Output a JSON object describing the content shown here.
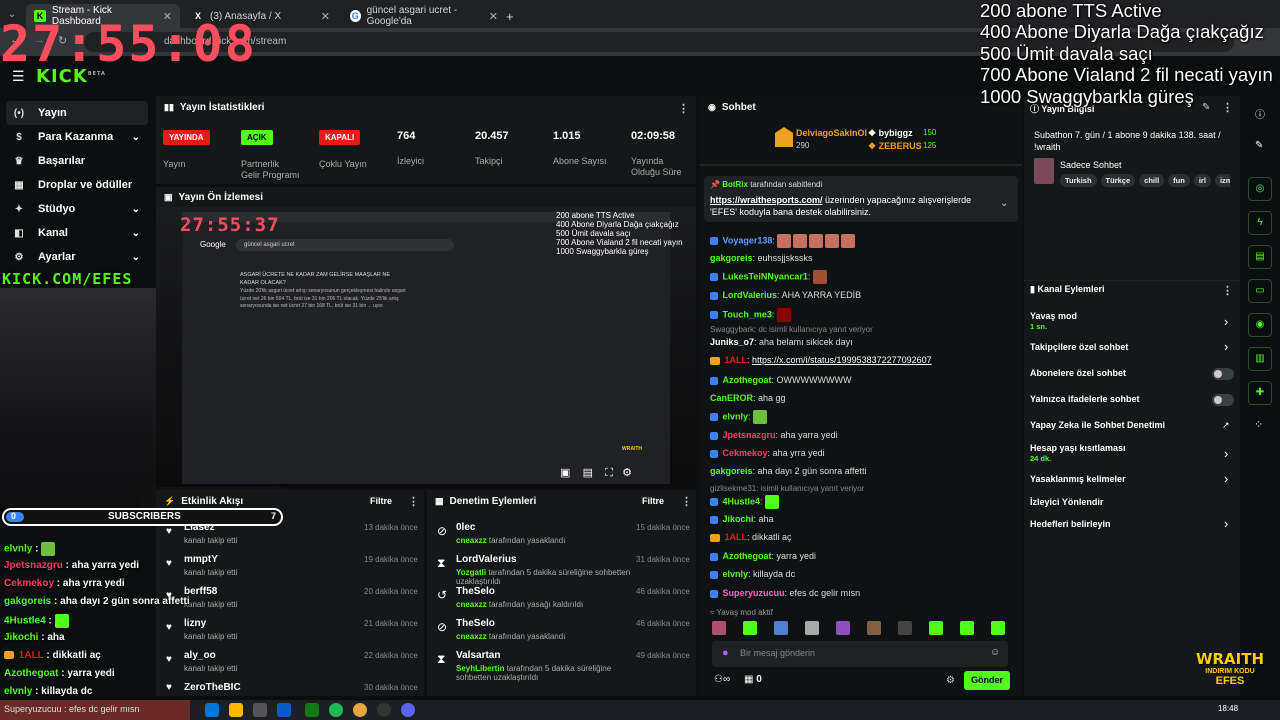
{
  "browser": {
    "tabs": [
      {
        "label": "Stream - Kick Dashboard",
        "fav": "K"
      },
      {
        "label": "(3) Anasayfa / X",
        "fav": "X"
      },
      {
        "label": "güncel asgari ucret - Google'da",
        "fav": "G"
      }
    ],
    "url": "dashboard.kick.com/stream",
    "new_tab": "+"
  },
  "overlay": {
    "timer": "27:55:08",
    "goals": [
      "200 abone TTS Active",
      "400 Abone Diyarla Dağa çıakçağız",
      "500 Ümit davala saçı",
      "700 Abone Vialand 2 fil necati yayın",
      "1000 Swaggybarkla güreş"
    ],
    "kick_url": "KICK.COM/EFES",
    "subscribers_label": "SUBSCRIBERS",
    "sub_start": "0",
    "sub_goal": "7",
    "wraith_logo": "WRAITH",
    "wraith_sub": "INDIRIM KODU",
    "wraith_name": "EFES",
    "chat": [
      {
        "user": "elvnly",
        "msg": ""
      },
      {
        "user": "Jpetsnazgru",
        "msg": "aha yarra yedi"
      },
      {
        "user": "Cekmekoy",
        "msg": "aha yrra yedi"
      },
      {
        "user": "gakgoreis",
        "msg": "aha dayı 2 gün sonra affetti"
      },
      {
        "user": "4Hustle4",
        "msg": ""
      },
      {
        "user": "Jikochi",
        "msg": "aha"
      },
      {
        "user": "1ALL",
        "msg": "dikkatli aç"
      },
      {
        "user": "Azothegoat",
        "msg": "yarra yedi"
      },
      {
        "user": "elvnly",
        "msg": "killayda dc"
      },
      {
        "user": "Superyuzucuu",
        "msg": "efes dc gelir mısn"
      }
    ]
  },
  "kick": {
    "logo": "KICK",
    "beta": "BETA"
  },
  "sidebar": {
    "items": [
      {
        "label": "Yayın",
        "icon": "(•)"
      },
      {
        "label": "Para Kazanma",
        "icon": "$"
      },
      {
        "label": "Başarılar",
        "icon": "♛"
      },
      {
        "label": "Droplar ve ödüller",
        "icon": "▦"
      },
      {
        "label": "Stüdyo",
        "icon": "✦"
      },
      {
        "label": "Kanal",
        "icon": "◧"
      },
      {
        "label": "Ayarlar",
        "icon": "⚙"
      }
    ]
  },
  "stats": {
    "title": "Yayın İstatistikleri",
    "cols": [
      {
        "badge": "YAYINDA",
        "label": "Yayın",
        "color": "#e91916"
      },
      {
        "badge": "AÇIK",
        "label": "Partnerlik\nGelir Programı",
        "color": "#53fc18"
      },
      {
        "badge": "KAPALI",
        "label": "Çoklu Yayın",
        "color": "#e91916"
      },
      {
        "value": "764",
        "label": "İzleyici"
      },
      {
        "value": "20.457",
        "label": "Takipçi"
      },
      {
        "value": "1.015",
        "label": "Abone Sayısı"
      },
      {
        "value": "02:09:58",
        "label": "Yayında\nOlduğu Süre"
      }
    ]
  },
  "preview": {
    "title": "Yayın Ön İzlemesi",
    "mini_timer": "27:55:37",
    "mini_goals": [
      "200 abone TTS Active",
      "400 Abone Diyarla Dağa çıakçağız",
      "500 Ümit davala saçı",
      "700 Abone Vialand 2 fil necati yayın",
      "1000 Swaggybarkla güreş"
    ],
    "google_query": "güncel asgari ucret",
    "google_logo": "Google",
    "snippet_q": "ASGARİ ÜCRETE NE KADAR ZAM GELİRSE MAAŞLAR NE KADAR OLACAK?",
    "snippet_a": "Yüzde 20'lik asgari ücret artışı senaryosunun gerçekleşmesi halinde asgari ücret net 26 bin 504 TL, brüt ise 31 bin 206 TL olacak. Yüzde 25'lik artış senaryosunda ise net ücret 27 bin 168 TL, brüt ise 31 bin ... uyor.",
    "wraith": "WRAITH"
  },
  "activity": {
    "title": "Etkinlik Akışı",
    "filter": "Filtre",
    "items": [
      {
        "name": "Liasez",
        "sub": "kanalı takip etti",
        "time": "13 dakika önce"
      },
      {
        "name": "mmptY",
        "sub": "kanalı takip etti",
        "time": "19 dakika önce"
      },
      {
        "name": "berff58",
        "sub": "kanalı takip etti",
        "time": "20 dakika önce"
      },
      {
        "name": "lizny",
        "sub": "kanalı takip etti",
        "time": "21 dakika önce"
      },
      {
        "name": "aly_oo",
        "sub": "kanalı takip etti",
        "time": "22 dakika önce"
      },
      {
        "name": "ZeroTheBIC",
        "sub": "",
        "time": "30 dakika önce"
      }
    ]
  },
  "moderation": {
    "title": "Denetim Eylemleri",
    "filter": "Filtre",
    "items": [
      {
        "name": "0lec",
        "by": "cneaxzz",
        "action": "tarafından yasaklandı",
        "time": "15 dakika önce",
        "icon": "⊘"
      },
      {
        "name": "LordValerius",
        "by": "Yozgatli",
        "action": "tarafından 5 dakika süreliğine sohbetten uzaklaştırıldı",
        "time": "31 dakika önce",
        "icon": "⧗"
      },
      {
        "name": "TheSelo",
        "by": "cneaxzz",
        "action": "tarafından yasağı kaldırıldı",
        "time": "46 dakika önce",
        "icon": "↺"
      },
      {
        "name": "TheSelo",
        "by": "cneaxzz",
        "action": "tarafından yasaklandı",
        "time": "46 dakika önce",
        "icon": "⊘"
      },
      {
        "name": "Valsartan",
        "by": "SeyhLibertin",
        "action": "tarafından 5 dakika süreliğine sohbetten uzaklaştırıldı",
        "time": "49 dakika önce",
        "icon": "⧗"
      }
    ]
  },
  "chat": {
    "title": "Sohbet",
    "top_gifter": {
      "name": "DelviagoSakinOl",
      "count": "290"
    },
    "gifter2": {
      "name": "bybiggz",
      "count": "150"
    },
    "gifter3": {
      "name": "ZEBERUS",
      "count": "125"
    },
    "pinned_by": "BotRix",
    "pinned_suffix": "tarafından sabitlendi",
    "pinned_link": "https://wraithesports.com/",
    "pinned_text": "üzerinden yapacağınız alışverişlerde 'EFES' koduyla bana destek olabilirsiniz.",
    "messages": [
      {
        "user": "Voyager138",
        "msg": "",
        "color": "#5aa0ff"
      },
      {
        "user": "gakgoreis",
        "msg": "euhssjjskssks",
        "color": "#53fc18"
      },
      {
        "user": "LukesTeiNNyancar1",
        "msg": "",
        "color": "#53fc18"
      },
      {
        "user": "LordValerius",
        "msg": "AHA YARRA YEDİB",
        "color": "#53fc18"
      },
      {
        "user": "Touch_me3",
        "msg": "",
        "color": "#53fc18"
      },
      {
        "user": "Juniks_o7",
        "msg": "aha belamı sikicek dayı",
        "color": "#ffffff"
      },
      {
        "user": "1ALL",
        "msg": "https://x.com/i/status/1999538372277092607",
        "color": "#e91916"
      },
      {
        "user": "Azothegoat",
        "msg": "OWWWWWWWW",
        "color": "#53fc18"
      },
      {
        "user": "CanEROR",
        "msg": "aha gg",
        "color": "#53fc18"
      },
      {
        "user": "elvnly",
        "msg": "",
        "color": "#53fc18"
      },
      {
        "user": "Jpetsnazgru",
        "msg": "aha yarra yedi",
        "color": "#ff3b6b"
      },
      {
        "user": "Cekmekoy",
        "msg": "aha yrra yedi",
        "color": "#ff3b6b"
      },
      {
        "user": "gakgoreis",
        "msg": "aha dayı 2 gün sonra affetti",
        "color": "#53fc18"
      },
      {
        "user": "4Hustle4",
        "msg": "",
        "color": "#53fc18"
      },
      {
        "user": "Jikochi",
        "msg": "aha",
        "color": "#53fc18"
      },
      {
        "user": "1ALL",
        "msg": "dikkatli aç",
        "color": "#e91916"
      },
      {
        "user": "Azothegoat",
        "msg": "yarra yedi",
        "color": "#53fc18"
      },
      {
        "user": "elvnly",
        "msg": "killayda dc",
        "color": "#53fc18"
      },
      {
        "user": "Superyuzucuu",
        "msg": "efes dc gelir mısn",
        "color": "#ff66cc"
      }
    ],
    "reply_note_1": "Swaggybark: dc isimli kullanıcıya yanıt veriyor",
    "reply_note_2": "gizlisekme31: isimli kullanıcıya yanıt veriyor",
    "slow_mode": "Yavaş mod aktif",
    "placeholder": "Bir mesaj gönderin",
    "send": "Gönder",
    "points": "0"
  },
  "stream_info": {
    "title": "Yayın Bilgisi",
    "text": "Subathon 7. gün / 1 abone 9 dakika 138. saat / !wraith",
    "category": "Sadece Sohbet",
    "tags": [
      "Turkish",
      "Türkçe",
      "chill",
      "fun",
      "irl",
      "izm"
    ]
  },
  "channel_actions": {
    "title": "Kanal Eylemleri",
    "items": [
      {
        "label": "Yavaş mod",
        "sub": "1 sn."
      },
      {
        "label": "Takipçilere özel sohbet",
        "sub": ""
      },
      {
        "label": "Abonelere özel sohbet",
        "sub": ""
      },
      {
        "label": "Yalnızca ifadelerle sohbet",
        "sub": ""
      },
      {
        "label": "Yapay Zeka ile Sohbet Denetimi",
        "sub": ""
      },
      {
        "label": "Hesap yaşı kısıtlaması",
        "sub": "24 dk."
      },
      {
        "label": "Yasaklanmış kelimeler",
        "sub": ""
      },
      {
        "label": "İzleyici Yönlendir",
        "sub": ""
      },
      {
        "label": "Hedefleri belirleyin",
        "sub": ""
      }
    ]
  },
  "taskbar": {
    "time": "18:48",
    "ticker": "Superyuzucuu : efes dc gelir mısn"
  }
}
